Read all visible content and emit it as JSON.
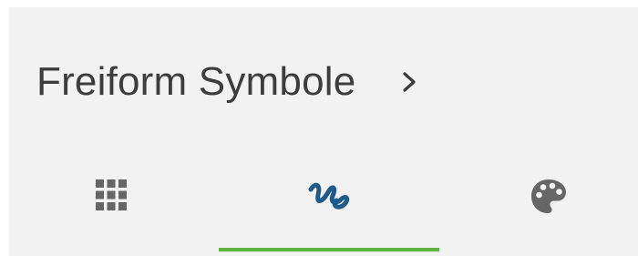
{
  "header": {
    "title": "Freiform Symbole",
    "chevron_icon": "chevron-right-icon"
  },
  "tabs": [
    {
      "id": "grid",
      "icon": "grid-icon",
      "selected": false
    },
    {
      "id": "freeform",
      "icon": "freeform-symbol-icon",
      "selected": true
    },
    {
      "id": "palette",
      "icon": "palette-icon",
      "selected": false
    }
  ],
  "colors": {
    "panel_background": "#f2f2f2",
    "text": "#3d3d3d",
    "icon_inactive": "#666666",
    "icon_active": "#1f5b8a",
    "selected_indicator": "#5cb340"
  }
}
